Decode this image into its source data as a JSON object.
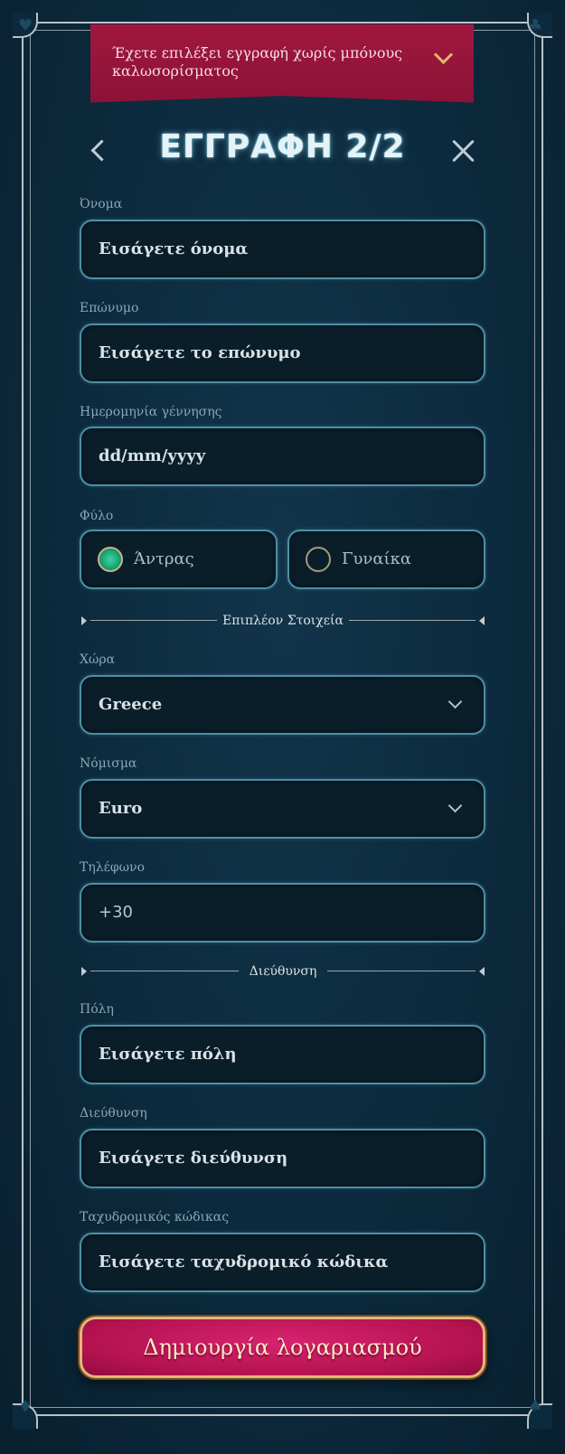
{
  "banner": {
    "text": "Έχετε επιλέξει εγγραφή χωρίς μπόνους καλωσορίσματος"
  },
  "header": {
    "title": "ΕΓΓΡΑΦΗ 2/2"
  },
  "fields": {
    "first_name": {
      "label": "Όνομα",
      "placeholder": "Εισάγετε όνομα"
    },
    "last_name": {
      "label": "Επώνυμο",
      "placeholder": "Εισάγετε το επώνυμο"
    },
    "birth_date": {
      "label": "Ημερομηνία γέννησης",
      "placeholder": "dd/mm/yyyy"
    },
    "gender": {
      "label": "Φύλο",
      "options": [
        "Άντρας",
        "Γυναίκα"
      ],
      "selected": "Άντρας"
    },
    "country": {
      "label": "Χώρα",
      "value": "Greece"
    },
    "currency": {
      "label": "Νόμισμα",
      "value": "Euro"
    },
    "phone": {
      "label": "Τηλέφωνο",
      "value": "+30"
    },
    "city": {
      "label": "Πόλη",
      "placeholder": "Εισάγετε πόλη"
    },
    "address": {
      "label": "Διεύθυνση",
      "placeholder": "Εισάγετε διεύθυνση"
    },
    "postal_code": {
      "label": "Ταχυδρομικός κώδικας",
      "placeholder": "Εισάγετε ταχυδρομικό κώδικα"
    }
  },
  "sections": {
    "extra": "Επιπλέον Στοιχεία",
    "address": "Διεύθυνση"
  },
  "submit": {
    "label": "Δημιουργία λογαριασμού"
  },
  "colors": {
    "accent": "#a0173f",
    "cta": "#c8185f",
    "input_border": "#4e8fa4",
    "radio_checked": "#1aa578"
  }
}
